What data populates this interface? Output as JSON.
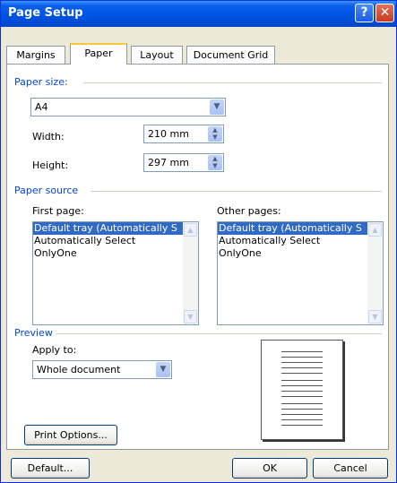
{
  "window": {
    "title": "Page Setup",
    "help_glyph": "?",
    "close_glyph": "✕"
  },
  "tabs": [
    "Margins",
    "Paper",
    "Layout",
    "Document Grid"
  ],
  "paper_size": {
    "group_label": "Paper size:",
    "selected": "A4",
    "width_label": "Width:",
    "width_value": "210 mm",
    "height_label": "Height:",
    "height_value": "297 mm"
  },
  "paper_source": {
    "group_label": "Paper source",
    "first_page_label": "First page:",
    "other_pages_label": "Other pages:",
    "first_page_items": [
      "Default tray (Automatically S",
      "Automatically Select",
      "OnlyOne"
    ],
    "other_pages_items": [
      "Default tray (Automatically S",
      "Automatically Select",
      "OnlyOne"
    ]
  },
  "preview": {
    "group_label": "Preview",
    "apply_to_label": "Apply to:",
    "apply_to_value": "Whole document"
  },
  "buttons": {
    "print_options": "Print Options...",
    "default": "Default...",
    "ok": "OK",
    "cancel": "Cancel"
  }
}
